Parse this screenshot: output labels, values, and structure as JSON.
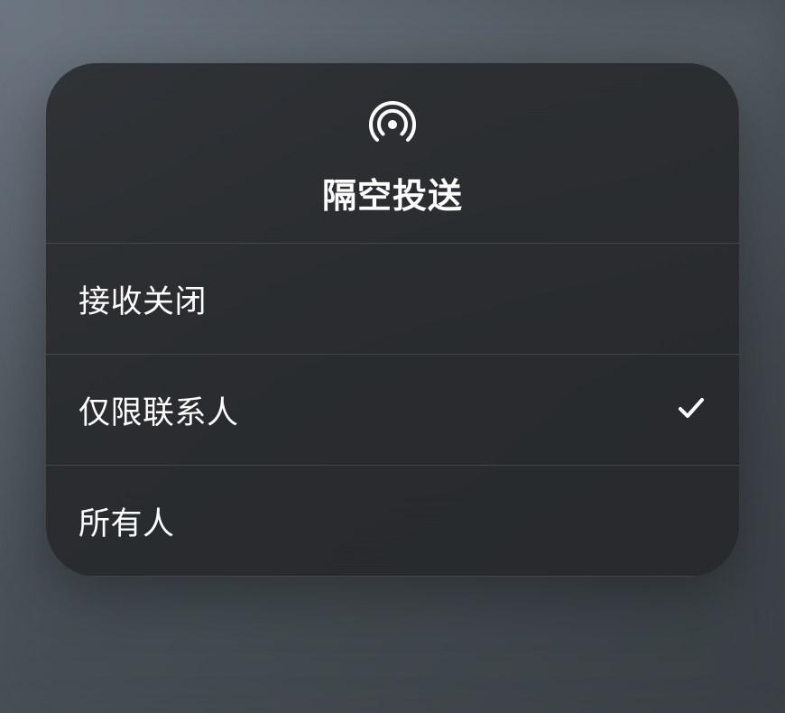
{
  "title": "隔空投送",
  "options": [
    {
      "label": "接收关闭",
      "selected": false
    },
    {
      "label": "仅限联系人",
      "selected": true
    },
    {
      "label": "所有人",
      "selected": false
    }
  ]
}
